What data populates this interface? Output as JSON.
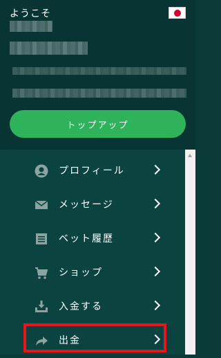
{
  "header": {
    "welcome": "ようこそ",
    "flag_icon": "japan-flag-icon",
    "topup_label": "トップアップ"
  },
  "menu": {
    "items": [
      {
        "label": "プロフィール",
        "icon": "profile-icon"
      },
      {
        "label": "メッセージ",
        "icon": "envelope-icon"
      },
      {
        "label": "ベット履歴",
        "icon": "list-icon"
      },
      {
        "label": "ショップ",
        "icon": "cart-icon"
      },
      {
        "label": "入金する",
        "icon": "deposit-icon"
      },
      {
        "label": "出金",
        "icon": "withdraw-arrow-icon"
      }
    ],
    "highlighted_item": "出金"
  },
  "colors": {
    "header_bg": "#083533",
    "menu_bg": "#0a4340",
    "topup_button": "#2eb25a",
    "highlight_border": "#e8161c"
  }
}
